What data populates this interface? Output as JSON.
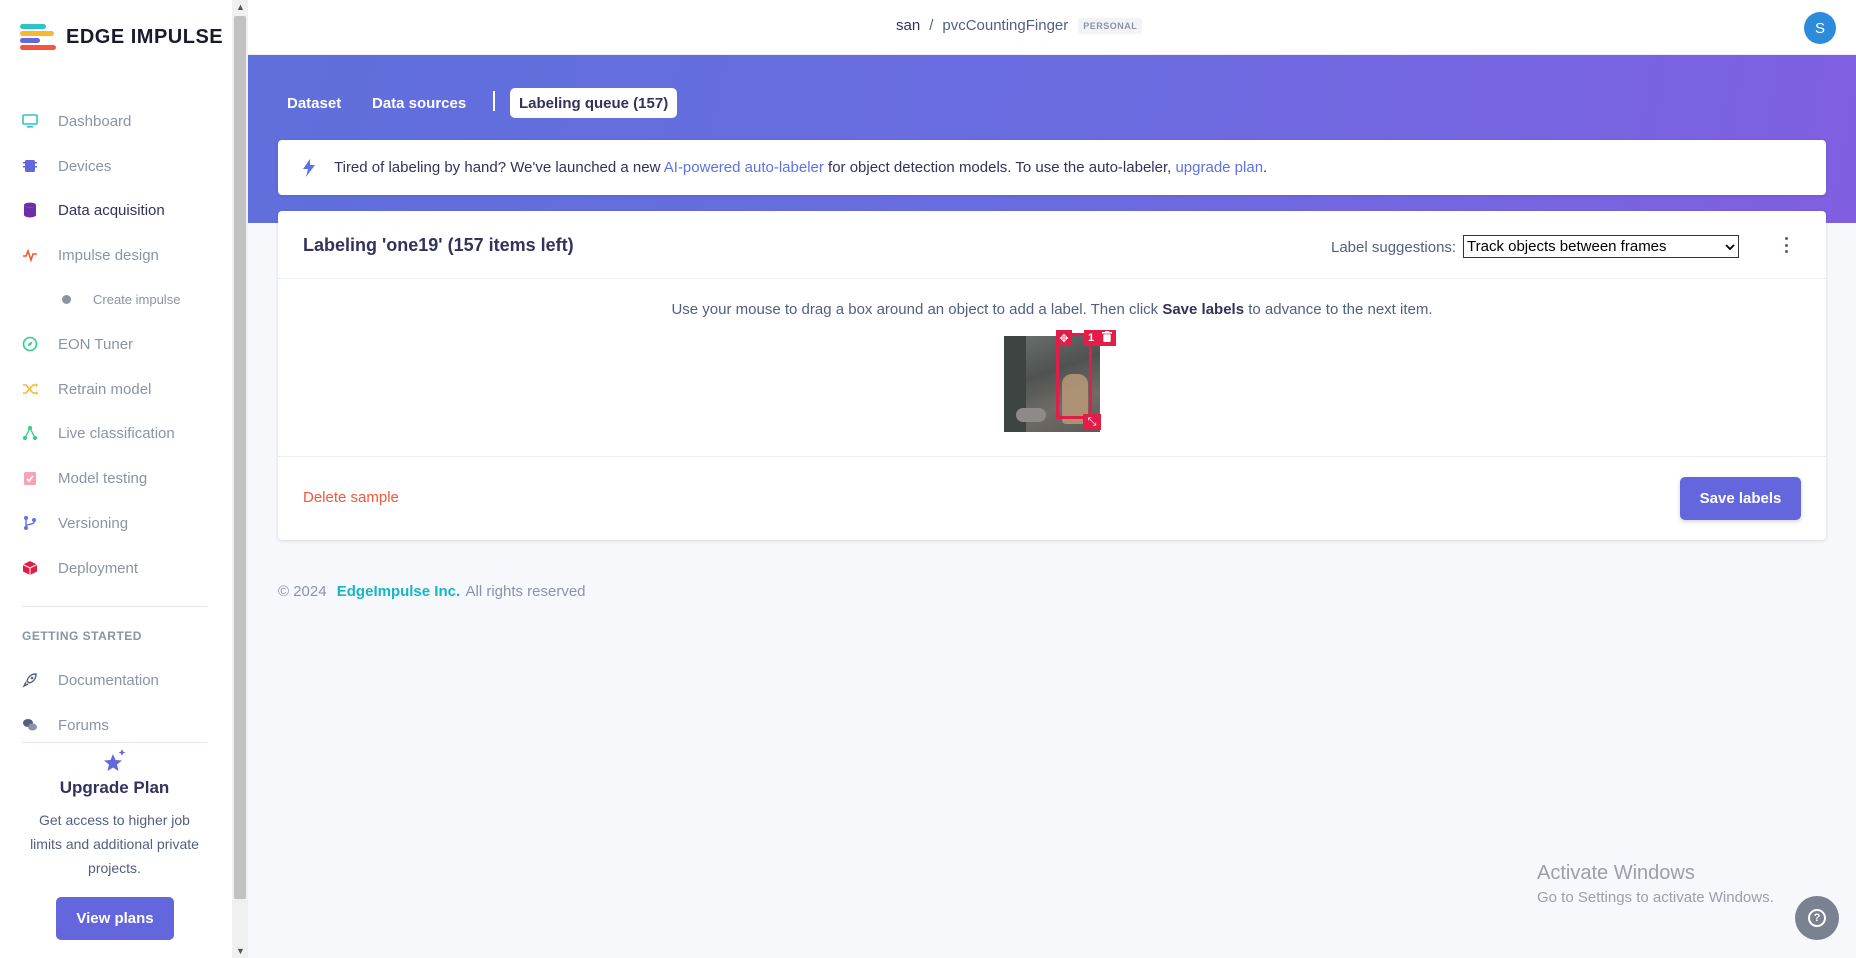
{
  "brand": {
    "name": "EDGE IMPULSE",
    "colors": {
      "accent": "#6366dd",
      "hero_start": "#5f6fdc",
      "hero_end": "#7f5fe0",
      "danger": "#e11d48",
      "teal": "#14b8c4"
    }
  },
  "sidebar": {
    "items": [
      {
        "label": "Dashboard",
        "icon": "monitor-icon"
      },
      {
        "label": "Devices",
        "icon": "chip-icon"
      },
      {
        "label": "Data acquisition",
        "icon": "database-icon",
        "active": true
      },
      {
        "label": "Impulse design",
        "icon": "pulse-icon"
      },
      {
        "label": "Create impulse",
        "icon": "dot-icon"
      },
      {
        "label": "EON Tuner",
        "icon": "compass-icon"
      },
      {
        "label": "Retrain model",
        "icon": "shuffle-icon"
      },
      {
        "label": "Live classification",
        "icon": "nodes-icon"
      },
      {
        "label": "Model testing",
        "icon": "clipboard-check-icon"
      },
      {
        "label": "Versioning",
        "icon": "branch-icon"
      },
      {
        "label": "Deployment",
        "icon": "cube-icon"
      }
    ],
    "section_title": "GETTING STARTED",
    "getting_started": [
      {
        "label": "Documentation",
        "icon": "rocket-icon"
      },
      {
        "label": "Forums",
        "icon": "chat-icon"
      }
    ],
    "upgrade": {
      "title": "Upgrade Plan",
      "text": "Get access to higher job limits and additional private projects.",
      "button": "View plans"
    }
  },
  "topbar": {
    "user": "san",
    "separator": "/",
    "project": "pvcCountingFinger",
    "badge": "PERSONAL",
    "avatar_initial": "S"
  },
  "tabs": [
    {
      "label": "Dataset"
    },
    {
      "label": "Data sources"
    },
    {
      "label": "Labeling queue (157)",
      "active": true
    }
  ],
  "banner": {
    "text_before": "Tired of labeling by hand? We've launched a new ",
    "link1": "AI-powered auto-labeler",
    "text_middle": " for object detection models. To use the auto-labeler, ",
    "link2": "upgrade plan",
    "text_after": "."
  },
  "labeling": {
    "title": "Labeling 'one19' (157 items left)",
    "suggestions_label": "Label suggestions:",
    "suggestions_value": "Track objects between frames",
    "instruction_before": "Use your mouse to drag a box around an object to add a label. Then click ",
    "instruction_bold": "Save labels",
    "instruction_after": " to advance to the next item.",
    "box_label": "1",
    "delete_label": "Delete sample",
    "save_label": "Save labels"
  },
  "footer": {
    "copyright": "© 2024",
    "company": "EdgeImpulse Inc.",
    "rights": "All rights reserved"
  },
  "watermark": {
    "line1": "Activate Windows",
    "line2": "Go to Settings to activate Windows."
  },
  "help": {
    "icon": "question-icon"
  }
}
